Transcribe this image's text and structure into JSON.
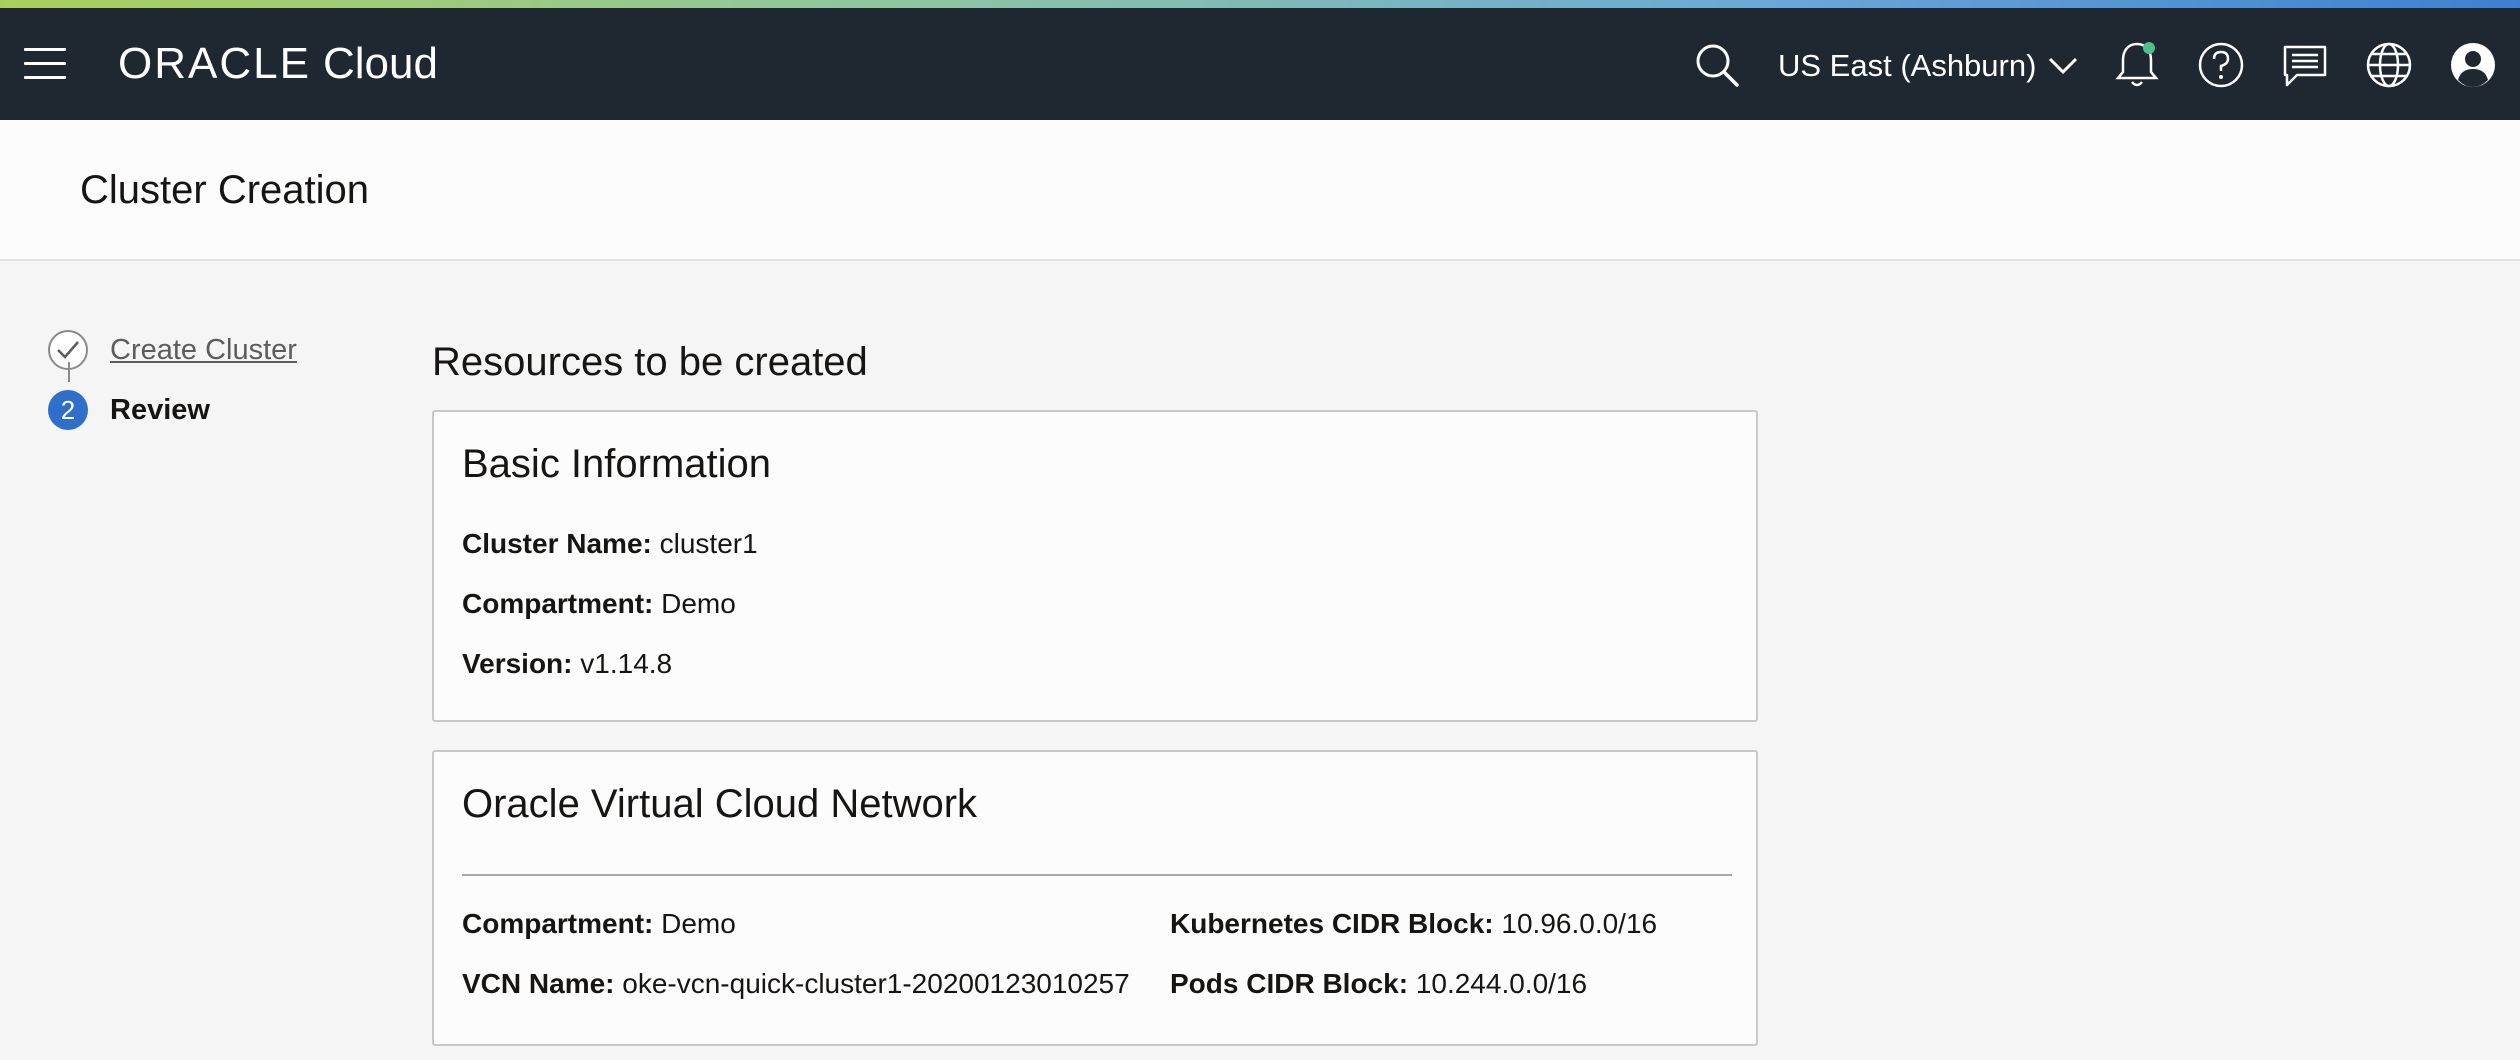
{
  "header": {
    "brand_oracle": "ORACLE",
    "brand_cloud": "Cloud",
    "region": "US East (Ashburn)",
    "icons": [
      "menu-icon",
      "search-icon",
      "chevron-down-icon",
      "bell-icon",
      "help-icon",
      "chat-icon",
      "globe-icon",
      "user-icon"
    ],
    "colors": {
      "topbar": "#1f2731",
      "notification_dot": "#4fc08d"
    }
  },
  "page": {
    "title": "Cluster Creation"
  },
  "steps": [
    {
      "label": "Create Cluster",
      "state": "completed"
    },
    {
      "number": "2",
      "label": "Review",
      "state": "active"
    }
  ],
  "main": {
    "section_title": "Resources to be created",
    "basic_info": {
      "title": "Basic Information",
      "fields": [
        {
          "label": "Cluster Name:",
          "value": "cluster1"
        },
        {
          "label": "Compartment:",
          "value": "Demo"
        },
        {
          "label": "Version:",
          "value": "v1.14.8"
        }
      ]
    },
    "vcn": {
      "title": "Oracle Virtual Cloud Network",
      "left_fields": [
        {
          "label": "Compartment:",
          "value": "Demo"
        },
        {
          "label": "VCN Name:",
          "value": "oke-vcn-quick-cluster1-20200123010257"
        }
      ],
      "right_fields": [
        {
          "label": "Kubernetes CIDR Block:",
          "value": "10.96.0.0/16"
        },
        {
          "label": "Pods CIDR Block:",
          "value": "10.244.0.0/16"
        }
      ]
    }
  },
  "accent_color": "#2f6fc9"
}
